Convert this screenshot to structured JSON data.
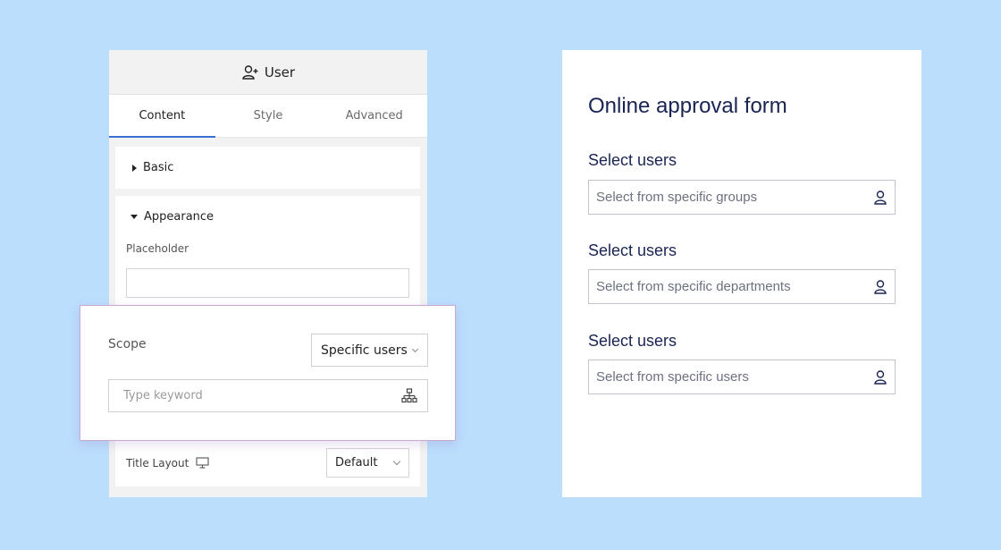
{
  "panel": {
    "header_title": "User",
    "header_icon": "user-add-icon",
    "tabs": [
      {
        "label": "Content",
        "active": true
      },
      {
        "label": "Style",
        "active": false
      },
      {
        "label": "Advanced",
        "active": false
      }
    ],
    "sections": {
      "basic": {
        "label": "Basic",
        "expanded": false
      },
      "appearance": {
        "label": "Appearance",
        "expanded": true,
        "placeholder_label": "Placeholder",
        "placeholder_value": "",
        "title_layout_label": "Title Layout",
        "title_layout_icon": "desktop-icon",
        "title_layout_value": "Default"
      }
    },
    "accent_color": "#3b6fd8"
  },
  "popup": {
    "scope_label": "Scope",
    "scope_value": "Specific users",
    "keyword_placeholder": "Type keyword",
    "keyword_value": "",
    "keyword_icon": "org-chart-icon"
  },
  "form": {
    "title": "Online approval form",
    "fields": [
      {
        "label": "Select users",
        "placeholder": "Select from specific groups",
        "icon": "user-icon"
      },
      {
        "label": "Select users",
        "placeholder": "Select from specific departments",
        "icon": "user-icon"
      },
      {
        "label": "Select users",
        "placeholder": "Select from specific users",
        "icon": "user-icon"
      }
    ],
    "text_color": "#1a2454"
  }
}
